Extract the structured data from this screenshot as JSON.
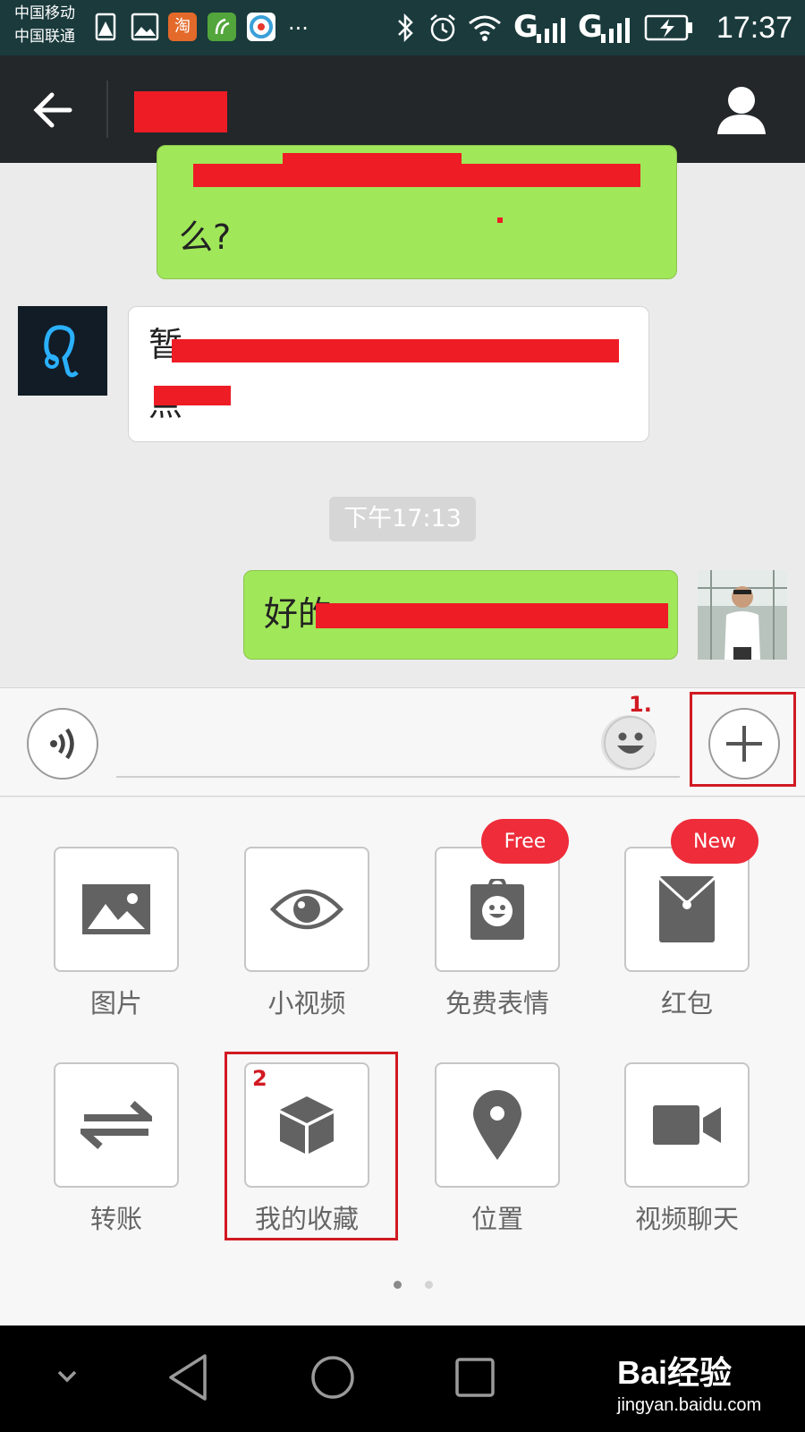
{
  "status_bar": {
    "carrier1": "中国移动",
    "carrier2": "中国联通",
    "taobao_label": "淘",
    "signal1_label": "G",
    "signal2_label": "G",
    "time": "17:37"
  },
  "chat": {
    "messages": [
      {
        "text_visible": "么?"
      },
      {
        "text_visible": "暂"
      },
      {
        "text_visible": "点"
      },
      {
        "text_visible": "好的"
      }
    ],
    "timestamp": "下午17:13"
  },
  "annotations": {
    "step1": "1.",
    "step2": "2"
  },
  "panel": {
    "items": [
      {
        "label": "图片",
        "icon": "image-icon"
      },
      {
        "label": "小视频",
        "icon": "eye-icon"
      },
      {
        "label": "免费表情",
        "icon": "sticker-icon",
        "badge": "Free"
      },
      {
        "label": "红包",
        "icon": "red-packet-icon",
        "badge": "New"
      },
      {
        "label": "转账",
        "icon": "transfer-icon"
      },
      {
        "label": "我的收藏",
        "icon": "cube-icon"
      },
      {
        "label": "位置",
        "icon": "location-pin-icon"
      },
      {
        "label": "视频聊天",
        "icon": "video-camera-icon"
      }
    ],
    "page_count": 2,
    "active_page": 1
  },
  "watermark": {
    "text": "Bai经验",
    "url": "jingyan.baidu.com"
  },
  "colors": {
    "bubble_green": "#a0e75a",
    "redaction": "#ee1c25",
    "badge": "#ee2c3a",
    "annotation": "#d11a22"
  }
}
